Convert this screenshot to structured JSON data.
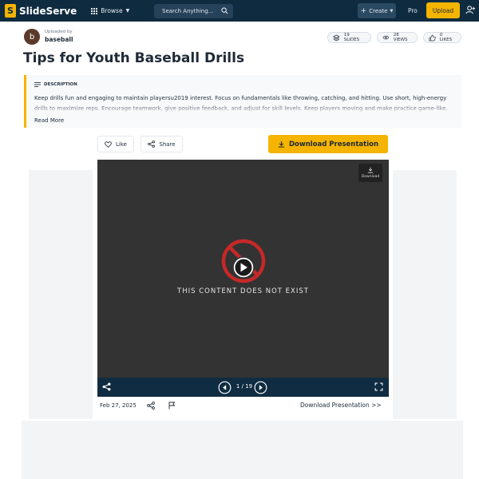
{
  "nav": {
    "logo_letter": "S",
    "logo_text": "SlideServe",
    "browse_label": "Browse",
    "search_placeholder": "Search Anything...",
    "create_label": "Create",
    "pro_label": "Pro",
    "upload_label": "Upload"
  },
  "uploader": {
    "avatar_letter": "b",
    "uploaded_by_label": "Uploaded by",
    "name": "baseball"
  },
  "stats": {
    "slides": "19 SLIDES",
    "views": "28 VIEWS",
    "likes": "0 LIKES"
  },
  "title": "Tips for Youth Baseball Drills",
  "description": {
    "heading": "DESCRIPTION",
    "text": "Keep drills fun and engaging to maintain playersu2019 interest. Focus on fundamentals like throwing, catching, and hitting. Use short, high-energy drills to maximize reps. Encourage teamwork, give positive feedback, and adjust for skill levels. Keep players moving and make practice game-like.",
    "read_more": "Read More"
  },
  "actions": {
    "like": "Like",
    "share": "Share",
    "download": "Download  Presentation"
  },
  "viewer": {
    "corner_download": "Download",
    "message": "THIS CONTENT DOES NOT EXIST",
    "page_indicator": "1 / 19"
  },
  "footer": {
    "date": "Feb 27, 2025",
    "download_link": "Download Presentation >>"
  },
  "colors": {
    "nav_bg": "#0f2b40",
    "accent": "#f4b400",
    "viewer_bg": "#333333",
    "error_red": "#c62828"
  }
}
